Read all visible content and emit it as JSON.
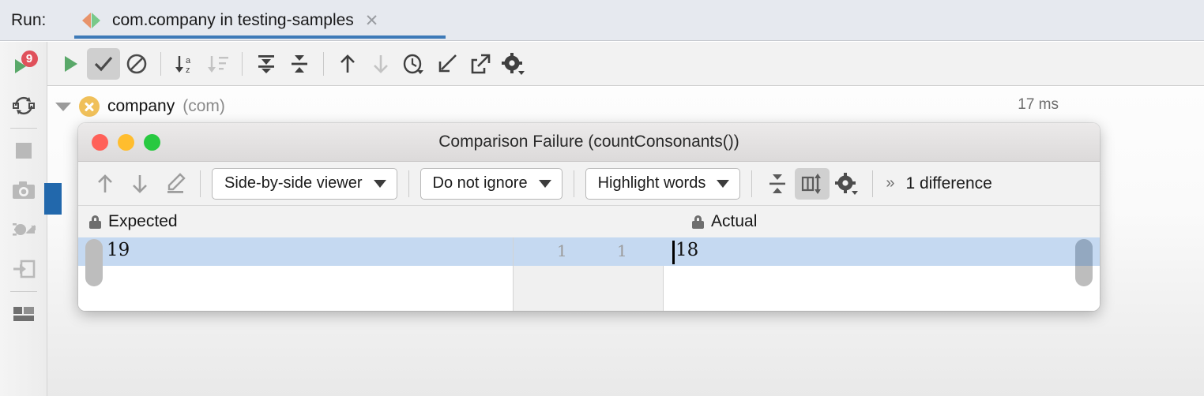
{
  "tabbar": {
    "run_label": "Run:",
    "tab_title": "com.company in testing-samples",
    "close_label": "✕",
    "accent_color": "#3d7ab8"
  },
  "left_toolbar": {
    "items": [
      {
        "name": "rerun-button",
        "icon": "play-icon",
        "badge": "9"
      },
      {
        "name": "rerun-failed-tests-button",
        "icon": "rerun-failed-icon",
        "badge": ""
      },
      {
        "name": "stop-button",
        "icon": "stop-square-icon",
        "badge": ""
      },
      {
        "name": "screenshot-button",
        "icon": "camera-icon",
        "badge": ""
      },
      {
        "name": "dump-threads-button",
        "icon": "bug-arrow-icon",
        "badge": ""
      },
      {
        "name": "restore-layout-button",
        "icon": "import-arrow-icon",
        "badge": ""
      },
      {
        "name": "layout-settings-button",
        "icon": "layout-icon",
        "badge": ""
      }
    ]
  },
  "toolbar": {
    "items": [
      {
        "name": "run-tests-button",
        "icon": "play-icon",
        "active": false
      },
      {
        "name": "show-passed-toggle",
        "icon": "checkmark-icon",
        "active": true
      },
      {
        "name": "show-ignored-toggle",
        "icon": "circle-slash-icon",
        "active": false
      },
      {
        "name": "sort-alphabetically-button",
        "icon": "sort-az-icon",
        "active": false
      },
      {
        "name": "sort-by-duration-button",
        "icon": "sort-duration-icon",
        "active": false
      },
      {
        "name": "expand-all-button",
        "icon": "expand-all-icon",
        "active": false
      },
      {
        "name": "collapse-all-button",
        "icon": "collapse-all-icon",
        "active": false
      },
      {
        "name": "previous-failed-button",
        "icon": "arrow-up-icon",
        "active": false
      },
      {
        "name": "next-failed-button",
        "icon": "arrow-down-icon",
        "active": false
      },
      {
        "name": "test-history-button",
        "icon": "clock-dropdown-icon",
        "active": false
      },
      {
        "name": "import-tests-button",
        "icon": "import-icon",
        "active": false
      },
      {
        "name": "export-tests-button",
        "icon": "export-icon",
        "active": false
      },
      {
        "name": "test-settings-button",
        "icon": "gear-dropdown-icon",
        "active": false
      }
    ]
  },
  "tree": {
    "row": {
      "name": "company",
      "package": "(com)",
      "duration": "17 ms",
      "status_icon": "failed-x-icon",
      "expanded": true
    }
  },
  "dialog": {
    "title": "Comparison Failure (countConsonants())",
    "window_controls": [
      {
        "name": "close-window-button",
        "color": "#ff6159"
      },
      {
        "name": "minimize-window-button",
        "color": "#ffbd2e"
      },
      {
        "name": "zoom-window-button",
        "color": "#28c940"
      }
    ],
    "toolbar": {
      "previous_difference": "arrow-up-icon",
      "next_difference": "arrow-down-icon",
      "edit_source": "pencil-icon",
      "viewer_mode": "Side-by-side viewer",
      "ignore_policy": "Do not ignore",
      "highlight_mode": "Highlight words",
      "collapse_unchanged": "collapse-unchanged-icon",
      "sync_scroll": "sync-columns-icon",
      "settings": "gear-dropdown-icon",
      "overflow": "»",
      "difference_count": "1 difference"
    },
    "panes": {
      "expected_label": "Expected",
      "actual_label": "Actual",
      "lock_icon": "lock-icon",
      "expected_value": "19",
      "actual_value": "18",
      "expected_line_number": "1",
      "actual_line_number": "1",
      "highlight_color": "#c5d9f1"
    }
  }
}
